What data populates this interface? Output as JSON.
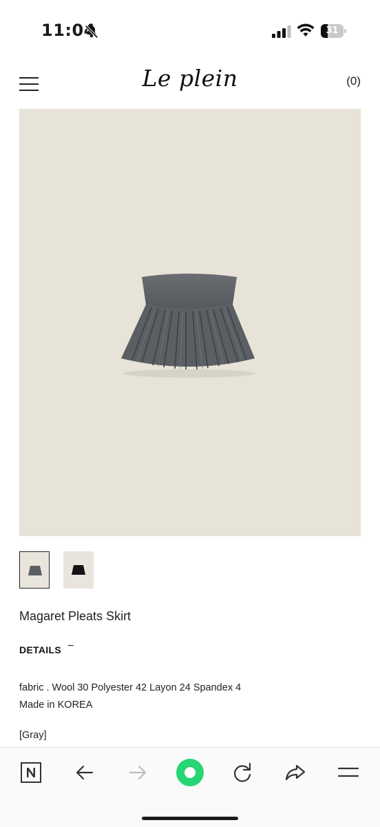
{
  "status_bar": {
    "time": "11:04",
    "battery_level": "31",
    "battery_fraction": 0.31,
    "icons": [
      "bell-slash-icon",
      "cellular-signal-icon",
      "wifi-icon",
      "battery-icon"
    ]
  },
  "header": {
    "logo": "Le plein",
    "cart_label": "(0)",
    "menu_icon": "hamburger-menu-icon"
  },
  "colors": {
    "hero_background": "#e7e3d9",
    "skirt_gray": "#5f6266",
    "browser_accent": "#27d574"
  },
  "product": {
    "name": "Magaret Pleats Skirt",
    "thumbnails": [
      {
        "color": "gray",
        "active": true
      },
      {
        "color": "black",
        "active": false
      }
    ],
    "details_label": "DETAILS",
    "details_toggle": "−",
    "fabric": "fabric . Wool 30 Polyester 42 Layon 24 Spandex 4",
    "origin": "Made in KOREA",
    "color_label": "[Gray]"
  },
  "browser_toolbar": {
    "buttons": [
      "naver-n-icon",
      "back-arrow-icon",
      "forward-arrow-icon",
      "green-dot-icon",
      "reload-icon",
      "share-icon",
      "menu-lines-icon"
    ]
  }
}
